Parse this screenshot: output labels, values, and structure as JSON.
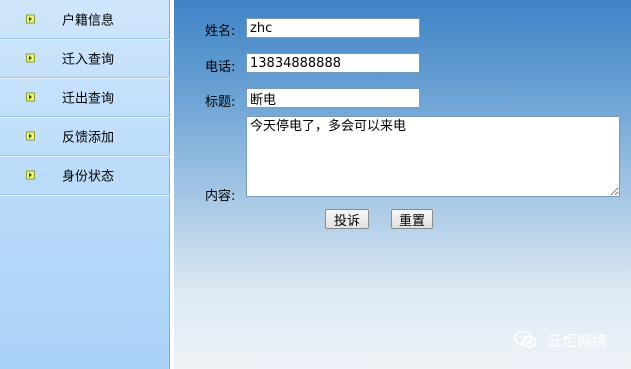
{
  "sidebar": {
    "items": [
      {
        "label": "户籍信息",
        "icon": "arrow-right-icon"
      },
      {
        "label": "迁入查询",
        "icon": "arrow-right-icon"
      },
      {
        "label": "迁出查询",
        "icon": "arrow-right-icon"
      },
      {
        "label": "反馈添加",
        "icon": "arrow-right-icon"
      },
      {
        "label": "身份状态",
        "icon": "arrow-right-icon"
      }
    ]
  },
  "form": {
    "name_label": "姓名:",
    "name_value": "zhc",
    "phone_label": "电话:",
    "phone_value": "13834888888",
    "title_label": "标题:",
    "title_value": "断电",
    "content_label": "内容:",
    "content_value": "今天停电了，多会可以来电",
    "submit_label": "投诉",
    "reset_label": "重置"
  },
  "watermark": {
    "text": "云炬网络",
    "icon": "wechat-icon"
  },
  "colors": {
    "sidebar_bg": "#bcdcf9",
    "main_top": "#3f83c6",
    "main_bottom": "#eef3f8"
  }
}
